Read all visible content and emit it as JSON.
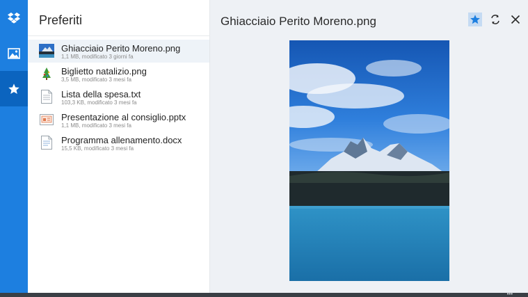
{
  "nav": {
    "items": [
      {
        "icon": "dropbox-logo-icon",
        "active": false
      },
      {
        "icon": "photos-icon",
        "active": false
      },
      {
        "icon": "star-icon",
        "active": true
      }
    ]
  },
  "list": {
    "title": "Preferiti",
    "files": [
      {
        "name": "Ghiacciaio Perito Moreno.png",
        "meta": "1,1 MB, modificato 3 giorni fa",
        "thumb": "image-thumbnail-icon",
        "selected": true
      },
      {
        "name": "Biglietto natalizio.png",
        "meta": "3,5 MB, modificato 3 mesi fa",
        "thumb": "image-thumbnail-icon",
        "selected": false
      },
      {
        "name": "Lista della spesa.txt",
        "meta": "103,3 KB, modificato 3 mesi fa",
        "thumb": "text-file-icon",
        "selected": false
      },
      {
        "name": "Presentazione al consiglio.pptx",
        "meta": "1,1 MB, modificato 3 mesi fa",
        "thumb": "presentation-file-icon",
        "selected": false
      },
      {
        "name": "Programma allenamento.docx",
        "meta": "15,5 KB, modificato 3 mesi fa",
        "thumb": "document-file-icon",
        "selected": false
      }
    ]
  },
  "preview": {
    "title": "Ghiacciaio Perito Moreno.png",
    "actions": [
      {
        "icon": "star-icon",
        "active": true
      },
      {
        "icon": "sync-icon",
        "active": false
      },
      {
        "icon": "close-icon",
        "active": false
      }
    ]
  },
  "taskbar": {
    "more": "•••"
  },
  "colors": {
    "accent": "#1d7fe0",
    "accent_dark": "#0b64bf",
    "selected_row": "#eef3f8"
  }
}
